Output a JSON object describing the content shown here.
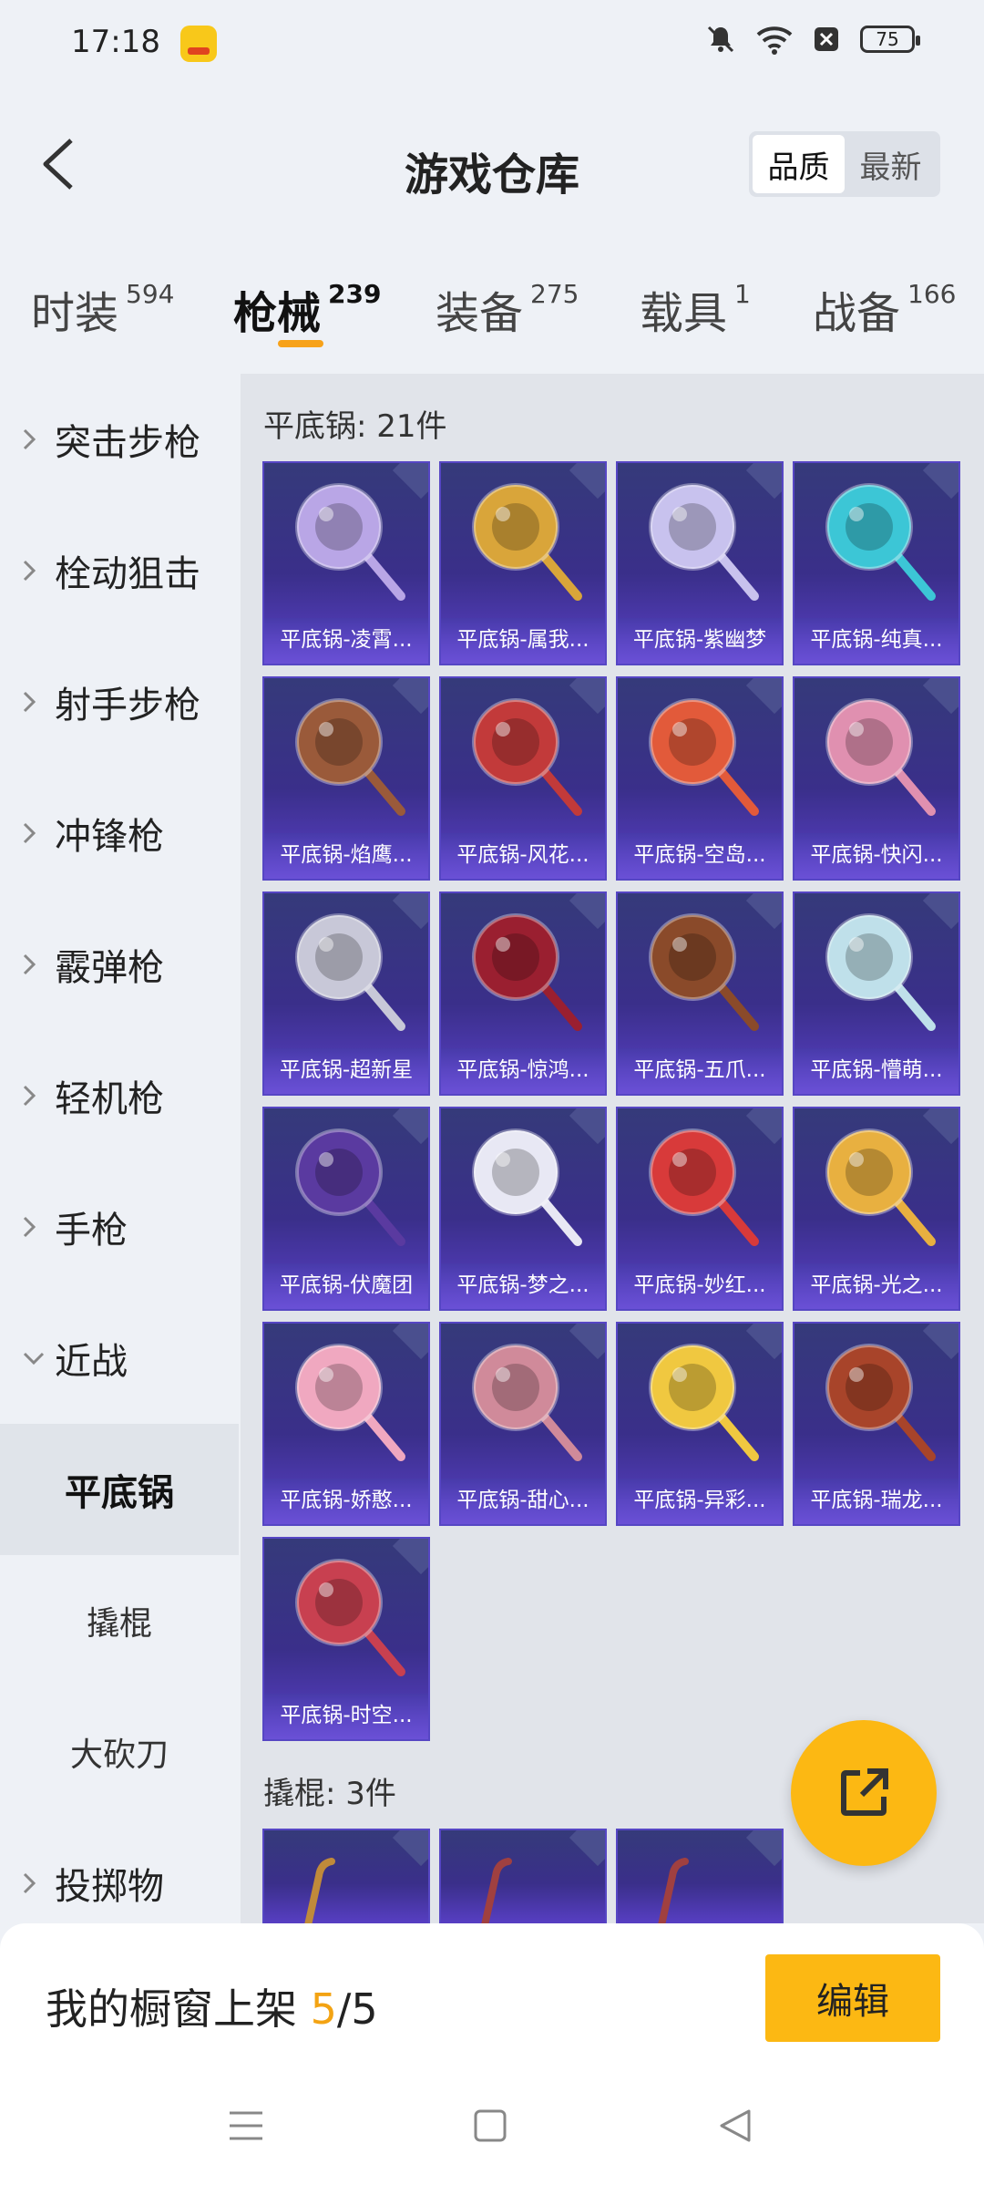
{
  "status_bar": {
    "time": "17:18",
    "battery": "75",
    "icons": [
      "mute-icon",
      "wifi-icon",
      "no-sim-icon",
      "battery-icon"
    ]
  },
  "header": {
    "title": "游戏仓库",
    "sort_options": [
      {
        "label": "品质",
        "active": true
      },
      {
        "label": "最新",
        "active": false
      }
    ]
  },
  "tabs": [
    {
      "label": "时装",
      "count": "594",
      "active": false
    },
    {
      "label": "枪械",
      "count": "239",
      "active": true
    },
    {
      "label": "装备",
      "count": "275",
      "active": false
    },
    {
      "label": "载具",
      "count": "1",
      "active": false
    },
    {
      "label": "战备",
      "count": "166",
      "active": false
    }
  ],
  "sidebar": {
    "items": [
      {
        "label": "突击步枪",
        "expanded": false
      },
      {
        "label": "栓动狙击",
        "expanded": false
      },
      {
        "label": "射手步枪",
        "expanded": false
      },
      {
        "label": "冲锋枪",
        "expanded": false
      },
      {
        "label": "霰弹枪",
        "expanded": false
      },
      {
        "label": "轻机枪",
        "expanded": false
      },
      {
        "label": "手枪",
        "expanded": false
      },
      {
        "label": "近战",
        "expanded": true
      }
    ],
    "sub_items": [
      {
        "label": "平底锅",
        "active": true
      },
      {
        "label": "撬棍",
        "active": false
      },
      {
        "label": "大砍刀",
        "active": false
      }
    ],
    "last_item": {
      "label": "投掷物",
      "expanded": false
    }
  },
  "sections": [
    {
      "title": "平底锅: 21件",
      "items": [
        {
          "name": "平底锅-凌霄...",
          "color": "#b9a6e6"
        },
        {
          "name": "平底锅-属我...",
          "color": "#d9a53a"
        },
        {
          "name": "平底锅-紫幽梦",
          "color": "#c8c2ee"
        },
        {
          "name": "平底锅-纯真...",
          "color": "#3cc6d6"
        },
        {
          "name": "平底锅-焰鹰...",
          "color": "#9a5a3a"
        },
        {
          "name": "平底锅-风花...",
          "color": "#c23a3a"
        },
        {
          "name": "平底锅-空岛...",
          "color": "#e25a3a"
        },
        {
          "name": "平底锅-快闪...",
          "color": "#e090b0"
        },
        {
          "name": "平底锅-超新星",
          "color": "#c8c8d8"
        },
        {
          "name": "平底锅-惊鸿...",
          "color": "#9a1f30"
        },
        {
          "name": "平底锅-五爪...",
          "color": "#8a4a2a"
        },
        {
          "name": "平底锅-懵萌...",
          "color": "#bfe0ea"
        },
        {
          "name": "平底锅-伏魔团",
          "color": "#5a3aa0"
        },
        {
          "name": "平底锅-梦之...",
          "color": "#e8e8f4"
        },
        {
          "name": "平底锅-妙红...",
          "color": "#d83a3a"
        },
        {
          "name": "平底锅-光之...",
          "color": "#e8b040"
        },
        {
          "name": "平底锅-娇憨...",
          "color": "#f0a8c0"
        },
        {
          "name": "平底锅-甜心...",
          "color": "#d08a9a"
        },
        {
          "name": "平底锅-异彩...",
          "color": "#f0c840"
        },
        {
          "name": "平底锅-瑞龙...",
          "color": "#a8442a"
        },
        {
          "name": "平底锅-时空...",
          "color": "#c84050"
        }
      ]
    },
    {
      "title": "撬棍: 3件",
      "items": [
        {
          "name": "",
          "color": "#c08a3a"
        },
        {
          "name": "",
          "color": "#a04040"
        },
        {
          "name": "",
          "color": "#a04040"
        }
      ]
    }
  ],
  "bottom": {
    "shelf_label": "我的橱窗上架",
    "shelf_current": "5",
    "shelf_total": "/5",
    "edit_label": "编辑"
  },
  "nav": {
    "icons": [
      "menu-icon",
      "home-icon",
      "back-triangle-icon"
    ]
  }
}
